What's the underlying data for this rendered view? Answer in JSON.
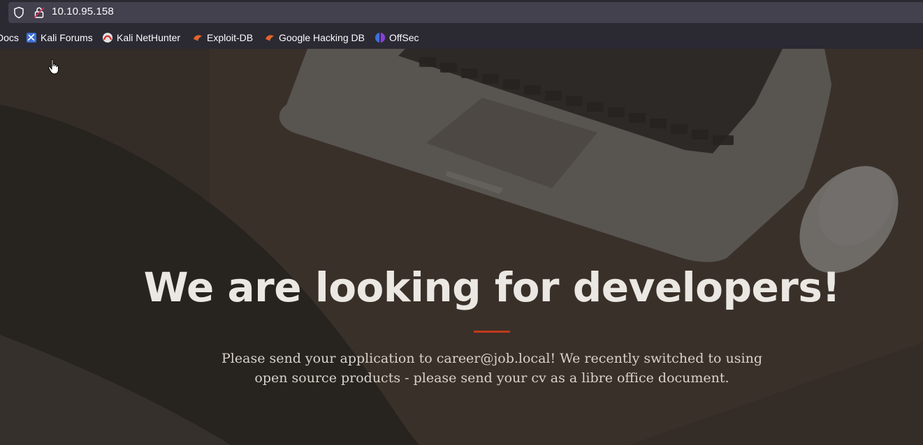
{
  "browser": {
    "url": "10.10.95.158"
  },
  "bookmarks": [
    {
      "label": "Docs",
      "icon": "kali-docs-icon"
    },
    {
      "label": "Kali Forums",
      "icon": "kali-forums-icon"
    },
    {
      "label": "Kali NetHunter",
      "icon": "kali-nethunter-icon"
    },
    {
      "label": "Exploit-DB",
      "icon": "exploit-db-icon"
    },
    {
      "label": "Google Hacking DB",
      "icon": "google-hacking-db-icon"
    },
    {
      "label": "OffSec",
      "icon": "offsec-icon"
    }
  ],
  "hero": {
    "headline": "We are looking for developers!",
    "description": "Please send your application to career@job.local! We recently switched to using open source products - please send your cv as a libre office document."
  },
  "colors": {
    "accent": "#c0391b",
    "toolbar": "#2b2a33",
    "url_field": "#42414d"
  }
}
